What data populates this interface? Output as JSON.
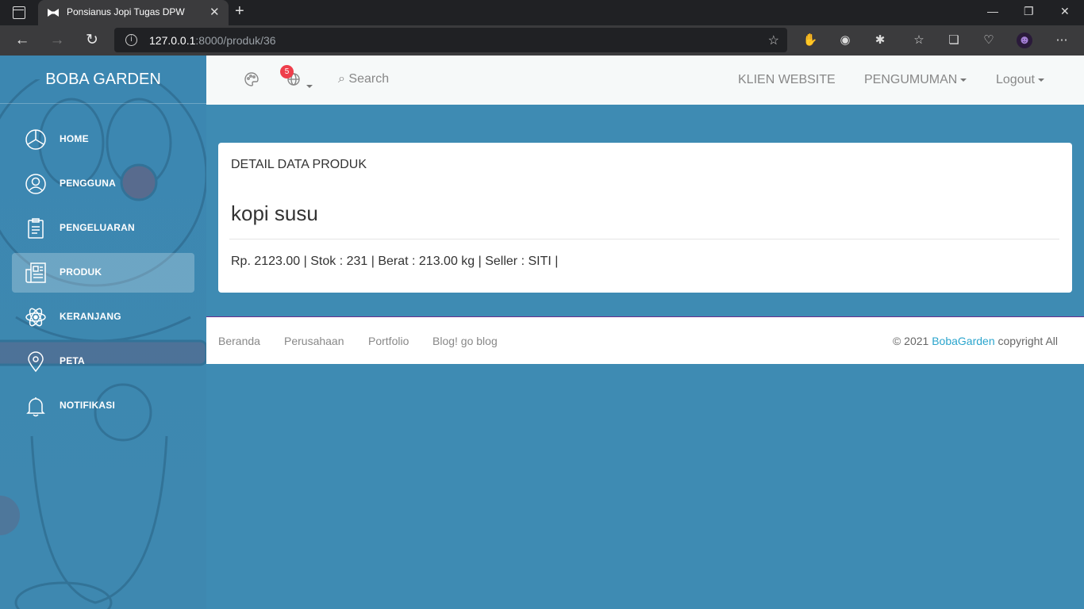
{
  "browser": {
    "tab_title": "Ponsianus Jopi Tugas DPW",
    "url_host": "127.0.0.1",
    "url_rest": ":8000/produk/36"
  },
  "brand": "BOBA GARDEN",
  "sidebar": {
    "items": [
      {
        "label": "HOME",
        "icon": "pie-chart-icon"
      },
      {
        "label": "PENGGUNA",
        "icon": "user-icon"
      },
      {
        "label": "PENGELUARAN",
        "icon": "clipboard-icon"
      },
      {
        "label": "PRODUK",
        "icon": "newspaper-icon",
        "active": true
      },
      {
        "label": "KERANJANG",
        "icon": "atom-icon"
      },
      {
        "label": "PETA",
        "icon": "map-pin-icon"
      },
      {
        "label": "NOTIFIKASI",
        "icon": "bell-icon"
      }
    ]
  },
  "topnav": {
    "notification_count": "5",
    "search_label": "Search",
    "klien_website": "KLIEN WEBSITE",
    "pengumuman": "PENGUMUMAN",
    "logout": "Logout"
  },
  "card": {
    "header": "DETAIL DATA PRODUK",
    "product_name": "kopi susu",
    "product_info": "Rp. 2123.00 | Stok : 231 | Berat : 213.00 kg | Seller : SITI |"
  },
  "footer": {
    "links": [
      "Beranda",
      "Perusahaan",
      "Portfolio",
      "Blog! go blog"
    ],
    "copyright_prefix": "© 2021 ",
    "copyright_brand": "BobaGarden",
    "copyright_suffix": " copyright All"
  },
  "colors": {
    "background": "#3e8bb3",
    "badge": "#ee3e4b",
    "link_accent": "#2ba5cd"
  }
}
